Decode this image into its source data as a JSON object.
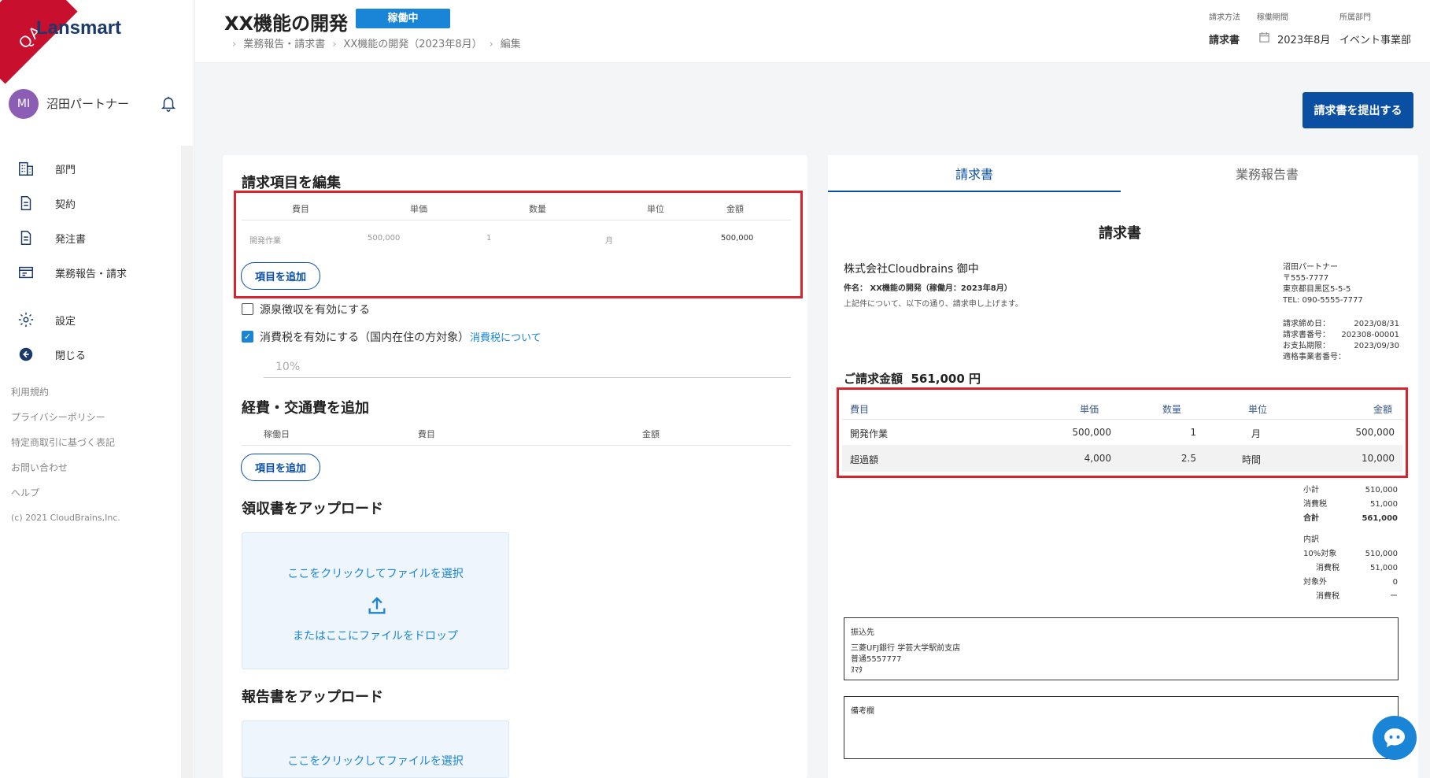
{
  "brand": {
    "ribbon": "QA",
    "logo": "Lansmart"
  },
  "user": {
    "initials": "MI",
    "name": "沼田パートナー"
  },
  "nav": [
    {
      "label": "部門",
      "icon": "building-icon"
    },
    {
      "label": "契約",
      "icon": "document-icon"
    },
    {
      "label": "発注書",
      "icon": "document-icon"
    },
    {
      "label": "業務報告・請求",
      "icon": "report-icon"
    },
    {
      "label": "設定",
      "icon": "gear-icon"
    },
    {
      "label": "閉じる",
      "icon": "arrow-left-circle-icon"
    }
  ],
  "footer_links": [
    "利用規約",
    "プライバシーポリシー",
    "特定商取引に基づく表記",
    "お問い合わせ",
    "ヘルプ",
    "(c) 2021 CloudBrains,Inc."
  ],
  "header": {
    "title": "XX機能の開発",
    "status": "稼働中",
    "breadcrumb": [
      "業務報告・請求書",
      "XX機能の開発（2023年8月）",
      "編集"
    ],
    "meta": {
      "method_label": "請求方法",
      "method_value": "請求書",
      "period_label": "稼働期間",
      "period_value": "2023年8月",
      "dept_label": "所属部門",
      "dept_value": "イベント事業部"
    }
  },
  "submit_label": "請求書を提出する",
  "edit": {
    "title": "請求項目を編集",
    "columns": [
      "費目",
      "単価",
      "数量",
      "単位",
      "金額"
    ],
    "rows": [
      [
        "開発作業",
        "500,000",
        "1",
        "月",
        "500,000"
      ]
    ],
    "add_label": "項目を追加",
    "withholding_label": "源泉徴収を有効にする",
    "withholding_checked": false,
    "tax_label": "消費税を有効にする（国内在住の方対象）",
    "tax_link": "消費税について",
    "tax_checked": true,
    "tax_rate": "10%"
  },
  "expenses": {
    "title": "経費・交通費を追加",
    "columns": [
      "稼働日",
      "費目",
      "金額"
    ],
    "add_label": "項目を追加"
  },
  "receipt_upload": {
    "title": "領収書をアップロード",
    "click_text": "ここをクリックしてファイルを選択",
    "drop_text": "またはここにファイルをドロップ"
  },
  "report_upload": {
    "title": "報告書をアップロード",
    "click_text": "ここをクリックしてファイルを選択"
  },
  "preview": {
    "tabs": [
      "請求書",
      "業務報告書"
    ],
    "active_tab": 0,
    "doc_title": "請求書",
    "client": "株式会社Cloudbrains 御中",
    "subject": "件名： XX機能の開発（稼働月：2023年8月）",
    "intro": "上記件について、以下の通り、請求申し上げます。",
    "issuer": [
      "沼田パートナー",
      "〒555-7777",
      "東京都目黒区5-5-5",
      "TEL: 090-5555-7777"
    ],
    "dates": [
      [
        "請求締め日：",
        "2023/08/31"
      ],
      [
        "請求書番号：",
        "202308-00001"
      ],
      [
        "お支払期限：",
        "2023/09/30"
      ],
      [
        "適格事業者番号：",
        ""
      ]
    ],
    "total_label": "ご請求金額",
    "total_value": "561,000 円",
    "columns": [
      "費目",
      "単価",
      "数量",
      "単位",
      "金額"
    ],
    "rows": [
      [
        "開発作業",
        "500,000",
        "1",
        "月",
        "500,000"
      ],
      [
        "超過額",
        "4,000",
        "2.5",
        "時間",
        "10,000"
      ]
    ],
    "summary": [
      [
        "小計",
        "510,000"
      ],
      [
        "消費税",
        "51,000"
      ],
      [
        "合計",
        "561,000"
      ]
    ],
    "breakdown_label": "内訳",
    "breakdown": [
      [
        "10%対象",
        "510,000"
      ],
      [
        "消費税",
        "51,000"
      ],
      [
        "対象外",
        "0"
      ],
      [
        "消費税",
        "ー"
      ]
    ],
    "bank_label": "振込先",
    "bank_lines": [
      "三菱UFJ銀行 学芸大学駅前支店",
      "普通5557777",
      "ﾇﾏﾀ"
    ],
    "remarks_label": "備考欄"
  }
}
